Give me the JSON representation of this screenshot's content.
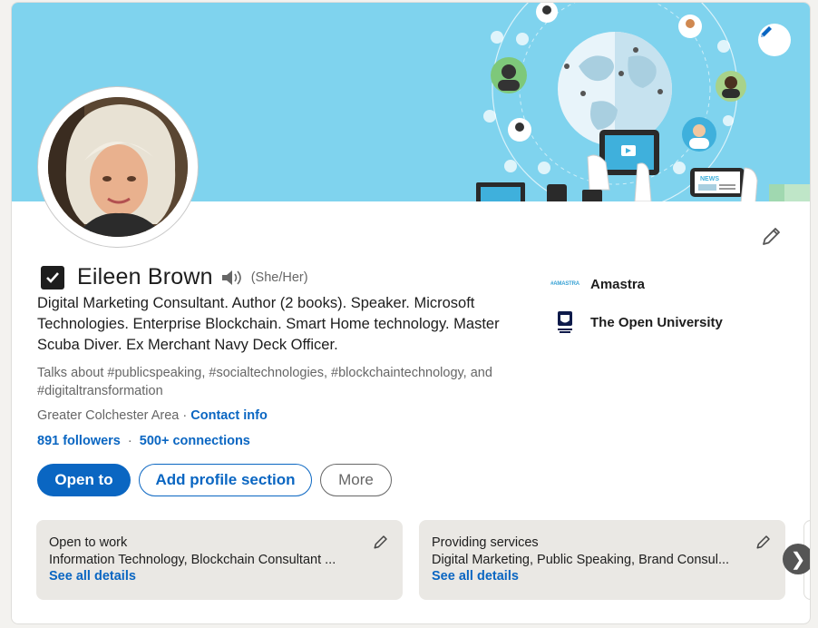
{
  "profile": {
    "name": "Eileen Brown",
    "pronouns": "(She/Her)",
    "headline": "Digital Marketing Consultant. Author (2 books). Speaker. Microsoft Technologies. Enterprise Blockchain. Smart Home technology. Master Scuba Diver. Ex Merchant Navy Deck Officer.",
    "talks_about": "Talks about #publicspeaking, #socialtechnologies, #blockchaintechnology, and #digitaltransformation",
    "location": "Greater Colchester Area",
    "location_separator": "·",
    "contact_info_label": "Contact info",
    "followers": "891 followers",
    "connections": "500+ connections",
    "counts_separator": "·"
  },
  "actions": {
    "open_to": "Open to",
    "add_profile_section": "Add profile section",
    "more": "More"
  },
  "organizations": [
    {
      "name": "Amastra",
      "logo_text": "#AMASTRA"
    },
    {
      "name": "The Open University"
    }
  ],
  "info_cards": [
    {
      "title": "Open to work",
      "body": "Information Technology, Blockchain Consultant ...",
      "link": "See all details"
    },
    {
      "title": "Providing services",
      "body": "Digital Marketing, Public Speaking, Brand Consul...",
      "link": "See all details"
    }
  ],
  "icons": {
    "banner_edit": "pencil-icon",
    "intro_edit": "pencil-icon",
    "verified": "checkbox-icon",
    "pronunciation": "speaker-icon",
    "carousel_next": "chevron-right-icon"
  },
  "colors": {
    "brand_blue": "#0a66c2",
    "banner_bg": "#7fd3ee",
    "card_bg": "#eae8e4",
    "page_bg": "#f3f2ef"
  }
}
